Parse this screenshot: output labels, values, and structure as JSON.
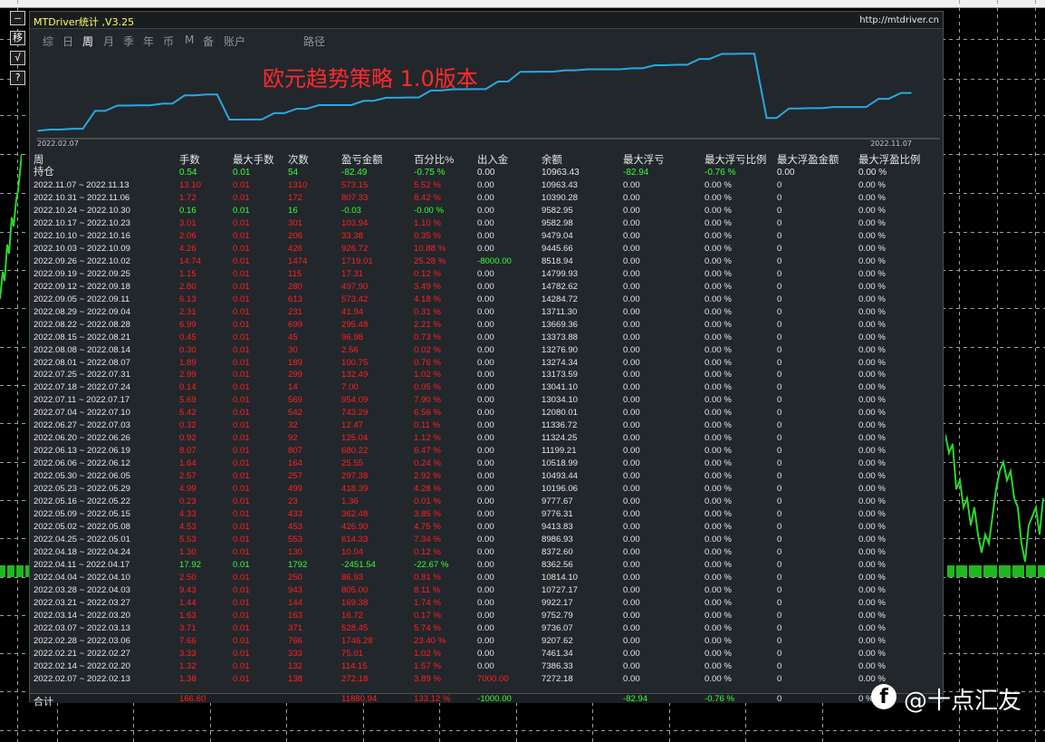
{
  "window": {
    "title": "MTDriver统计 ,V3.25",
    "url": "http://mtdriver.cn"
  },
  "toolbar_buttons": [
    "—",
    "移",
    "√",
    "?"
  ],
  "tabs": [
    {
      "label": "综",
      "active": false
    },
    {
      "label": "日",
      "active": false
    },
    {
      "label": "周",
      "active": true
    },
    {
      "label": "月",
      "active": false
    },
    {
      "label": "季",
      "active": false
    },
    {
      "label": "年",
      "active": false
    },
    {
      "label": "币",
      "active": false
    },
    {
      "label": "M",
      "active": false
    },
    {
      "label": "备",
      "active": false
    },
    {
      "label": "账户",
      "active": false
    },
    {
      "label": "路径",
      "active": false
    }
  ],
  "chart": {
    "title": "欧元趋势策略 1.0版本",
    "start_date": "2022.02.07",
    "end_date": "2022.11.07",
    "line_color": "#29a8e0"
  },
  "chart_data": {
    "type": "line",
    "title": "欧元趋势策略 1.0版本",
    "x_labels": [
      "2022.02.07",
      "2022.11.07"
    ],
    "series": [
      {
        "values": [
          7272.18,
          7386.33,
          7461.34,
          9207.62,
          9736.07,
          9752.79,
          9922.17,
          10727.17,
          10814.1,
          8362.56,
          8372.6,
          8986.93,
          9413.83,
          9776.31,
          9777.67,
          10196.06,
          10493.44,
          10518.99,
          11199.21,
          11324.25,
          11336.72,
          12080.01,
          13034.1,
          13041.1,
          13173.59,
          13274.34,
          13276.9,
          13373.88,
          13669.36,
          13711.3,
          14284.72,
          14782.62,
          14799.93,
          8518.94,
          9445.66,
          9479.04,
          9582.98,
          9582.95,
          10390.28,
          10963.43
        ]
      }
    ]
  },
  "table": {
    "headers": [
      "周",
      "手数",
      "最大手数",
      "次数",
      "盈亏金额",
      "百分比%",
      "出入金",
      "余额",
      "最大浮亏",
      "最大浮亏比例",
      "最大浮盈金额",
      "最大浮盈比例"
    ],
    "position": {
      "label": "持仓",
      "lots": "0.54",
      "max_lots": "0.01",
      "count": "54",
      "pnl": "-82.49",
      "pct": "-0.75 %",
      "flow": "0.00",
      "balance": "10963.43",
      "max_dd": "-82.94",
      "max_dd_pct": "-0.76 %",
      "max_fp": "0.00",
      "max_fp_pct": "0.00 %"
    },
    "rows": [
      [
        "2022.11.07 ~ 2022.11.13",
        "13.10",
        "0.01",
        "1310",
        "573.15",
        "5.52 %",
        "0.00",
        "10963.43",
        "0.00",
        "0.00 %",
        "0",
        "0.00 %"
      ],
      [
        "2022.10.31 ~ 2022.11.06",
        "1.72",
        "0.01",
        "172",
        "807.33",
        "8.42 %",
        "0.00",
        "10390.28",
        "0.00",
        "0.00 %",
        "0",
        "0.00 %"
      ],
      [
        "2022.10.24 ~ 2022.10.30",
        "0.16",
        "0.01",
        "16",
        "-0.03",
        "-0.00 %",
        "0.00",
        "9582.95",
        "0.00",
        "0.00 %",
        "0",
        "0.00 %"
      ],
      [
        "2022.10.17 ~ 2022.10.23",
        "3.01",
        "0.01",
        "301",
        "103.94",
        "1.10 %",
        "0.00",
        "9582.98",
        "0.00",
        "0.00 %",
        "0",
        "0.00 %"
      ],
      [
        "2022.10.10 ~ 2022.10.16",
        "2.06",
        "0.01",
        "206",
        "33.38",
        "0.35 %",
        "0.00",
        "9479.04",
        "0.00",
        "0.00 %",
        "0",
        "0.00 %"
      ],
      [
        "2022.10.03 ~ 2022.10.09",
        "4.26",
        "0.01",
        "426",
        "926.72",
        "10.88 %",
        "0.00",
        "9445.66",
        "0.00",
        "0.00 %",
        "0",
        "0.00 %"
      ],
      [
        "2022.09.26 ~ 2022.10.02",
        "14.74",
        "0.01",
        "1474",
        "1719.01",
        "25.28 %",
        "-8000.00",
        "8518.94",
        "0.00",
        "0.00 %",
        "0",
        "0.00 %"
      ],
      [
        "2022.09.19 ~ 2022.09.25",
        "1.15",
        "0.01",
        "115",
        "17.31",
        "0.12 %",
        "0.00",
        "14799.93",
        "0.00",
        "0.00 %",
        "0",
        "0.00 %"
      ],
      [
        "2022.09.12 ~ 2022.09.18",
        "2.80",
        "0.01",
        "280",
        "497.90",
        "3.49 %",
        "0.00",
        "14782.62",
        "0.00",
        "0.00 %",
        "0",
        "0.00 %"
      ],
      [
        "2022.09.05 ~ 2022.09.11",
        "6.13",
        "0.01",
        "613",
        "573.42",
        "4.18 %",
        "0.00",
        "14284.72",
        "0.00",
        "0.00 %",
        "0",
        "0.00 %"
      ],
      [
        "2022.08.29 ~ 2022.09.04",
        "2.31",
        "0.01",
        "231",
        "41.94",
        "0.31 %",
        "0.00",
        "13711.30",
        "0.00",
        "0.00 %",
        "0",
        "0.00 %"
      ],
      [
        "2022.08.22 ~ 2022.08.28",
        "6.99",
        "0.01",
        "699",
        "295.48",
        "2.21 %",
        "0.00",
        "13669.36",
        "0.00",
        "0.00 %",
        "0",
        "0.00 %"
      ],
      [
        "2022.08.15 ~ 2022.08.21",
        "0.45",
        "0.01",
        "45",
        "96.98",
        "0.73 %",
        "0.00",
        "13373.88",
        "0.00",
        "0.00 %",
        "0",
        "0.00 %"
      ],
      [
        "2022.08.08 ~ 2022.08.14",
        "0.30",
        "0.01",
        "30",
        "2.56",
        "0.02 %",
        "0.00",
        "13276.90",
        "0.00",
        "0.00 %",
        "0",
        "0.00 %"
      ],
      [
        "2022.08.01 ~ 2022.08.07",
        "1.89",
        "0.01",
        "189",
        "100.75",
        "0.76 %",
        "0.00",
        "13274.34",
        "0.00",
        "0.00 %",
        "0",
        "0.00 %"
      ],
      [
        "2022.07.25 ~ 2022.07.31",
        "2.99",
        "0.01",
        "299",
        "132.49",
        "1.02 %",
        "0.00",
        "13173.59",
        "0.00",
        "0.00 %",
        "0",
        "0.00 %"
      ],
      [
        "2022.07.18 ~ 2022.07.24",
        "0.14",
        "0.01",
        "14",
        "7.00",
        "0.05 %",
        "0.00",
        "13041.10",
        "0.00",
        "0.00 %",
        "0",
        "0.00 %"
      ],
      [
        "2022.07.11 ~ 2022.07.17",
        "5.69",
        "0.01",
        "569",
        "954.09",
        "7.90 %",
        "0.00",
        "13034.10",
        "0.00",
        "0.00 %",
        "0",
        "0.00 %"
      ],
      [
        "2022.07.04 ~ 2022.07.10",
        "5.42",
        "0.01",
        "542",
        "743.29",
        "6.56 %",
        "0.00",
        "12080.01",
        "0.00",
        "0.00 %",
        "0",
        "0.00 %"
      ],
      [
        "2022.06.27 ~ 2022.07.03",
        "0.32",
        "0.01",
        "32",
        "12.47",
        "0.11 %",
        "0.00",
        "11336.72",
        "0.00",
        "0.00 %",
        "0",
        "0.00 %"
      ],
      [
        "2022.06.20 ~ 2022.06.26",
        "0.92",
        "0.01",
        "92",
        "125.04",
        "1.12 %",
        "0.00",
        "11324.25",
        "0.00",
        "0.00 %",
        "0",
        "0.00 %"
      ],
      [
        "2022.06.13 ~ 2022.06.19",
        "8.07",
        "0.01",
        "807",
        "680.22",
        "6.47 %",
        "0.00",
        "11199.21",
        "0.00",
        "0.00 %",
        "0",
        "0.00 %"
      ],
      [
        "2022.06.06 ~ 2022.06.12",
        "1.64",
        "0.01",
        "164",
        "25.55",
        "0.24 %",
        "0.00",
        "10518.99",
        "0.00",
        "0.00 %",
        "0",
        "0.00 %"
      ],
      [
        "2022.05.30 ~ 2022.06.05",
        "2.57",
        "0.01",
        "257",
        "297.38",
        "2.92 %",
        "0.00",
        "10493.44",
        "0.00",
        "0.00 %",
        "0",
        "0.00 %"
      ],
      [
        "2022.05.23 ~ 2022.05.29",
        "4.99",
        "0.01",
        "499",
        "418.39",
        "4.28 %",
        "0.00",
        "10196.06",
        "0.00",
        "0.00 %",
        "0",
        "0.00 %"
      ],
      [
        "2022.05.16 ~ 2022.05.22",
        "0.23",
        "0.01",
        "23",
        "1.36",
        "0.01 %",
        "0.00",
        "9777.67",
        "0.00",
        "0.00 %",
        "0",
        "0.00 %"
      ],
      [
        "2022.05.09 ~ 2022.05.15",
        "4.33",
        "0.01",
        "433",
        "362.48",
        "3.85 %",
        "0.00",
        "9776.31",
        "0.00",
        "0.00 %",
        "0",
        "0.00 %"
      ],
      [
        "2022.05.02 ~ 2022.05.08",
        "4.53",
        "0.01",
        "453",
        "426.90",
        "4.75 %",
        "0.00",
        "9413.83",
        "0.00",
        "0.00 %",
        "0",
        "0.00 %"
      ],
      [
        "2022.04.25 ~ 2022.05.01",
        "5.53",
        "0.01",
        "553",
        "614.33",
        "7.34 %",
        "0.00",
        "8986.93",
        "0.00",
        "0.00 %",
        "0",
        "0.00 %"
      ],
      [
        "2022.04.18 ~ 2022.04.24",
        "1.30",
        "0.01",
        "130",
        "10.04",
        "0.12 %",
        "0.00",
        "8372.60",
        "0.00",
        "0.00 %",
        "0",
        "0.00 %"
      ],
      [
        "2022.04.11 ~ 2022.04.17",
        "17.92",
        "0.01",
        "1792",
        "-2451.54",
        "-22.67 %",
        "0.00",
        "8362.56",
        "0.00",
        "0.00 %",
        "0",
        "0.00 %"
      ],
      [
        "2022.04.04 ~ 2022.04.10",
        "2.50",
        "0.01",
        "250",
        "86.93",
        "0.81 %",
        "0.00",
        "10814.10",
        "0.00",
        "0.00 %",
        "0",
        "0.00 %"
      ],
      [
        "2022.03.28 ~ 2022.04.03",
        "9.43",
        "0.01",
        "943",
        "805.00",
        "8.11 %",
        "0.00",
        "10727.17",
        "0.00",
        "0.00 %",
        "0",
        "0.00 %"
      ],
      [
        "2022.03.21 ~ 2022.03.27",
        "1.44",
        "0.01",
        "144",
        "169.38",
        "1.74 %",
        "0.00",
        "9922.17",
        "0.00",
        "0.00 %",
        "0",
        "0.00 %"
      ],
      [
        "2022.03.14 ~ 2022.03.20",
        "1.63",
        "0.01",
        "163",
        "16.72",
        "0.17 %",
        "0.00",
        "9752.79",
        "0.00",
        "0.00 %",
        "0",
        "0.00 %"
      ],
      [
        "2022.03.07 ~ 2022.03.13",
        "3.71",
        "0.01",
        "371",
        "528.45",
        "5.74 %",
        "0.00",
        "9736.07",
        "0.00",
        "0.00 %",
        "0",
        "0.00 %"
      ],
      [
        "2022.02.28 ~ 2022.03.06",
        "7.66",
        "0.01",
        "766",
        "1746.28",
        "23.40 %",
        "0.00",
        "9207.62",
        "0.00",
        "0.00 %",
        "0",
        "0.00 %"
      ],
      [
        "2022.02.21 ~ 2022.02.27",
        "3.33",
        "0.01",
        "333",
        "75.01",
        "1.02 %",
        "0.00",
        "7461.34",
        "0.00",
        "0.00 %",
        "0",
        "0.00 %"
      ],
      [
        "2022.02.14 ~ 2022.02.20",
        "1.32",
        "0.01",
        "132",
        "114.15",
        "1.57 %",
        "0.00",
        "7386.33",
        "0.00",
        "0.00 %",
        "0",
        "0.00 %"
      ],
      [
        "2022.02.07 ~ 2022.02.13",
        "1.38",
        "0.01",
        "138",
        "272.18",
        "3.89 %",
        "7000.00",
        "7272.18",
        "0.00",
        "0.00 %",
        "0",
        "0.00 %"
      ]
    ],
    "totals": {
      "label": "合计",
      "lots": "166.60",
      "pnl": "11880.94",
      "pct": "133.12 %",
      "flow": "-1000.00",
      "max_dd": "-82.94",
      "max_dd_pct": "-0.76 %",
      "max_fp": "0",
      "max_fp_pct": "0 %"
    }
  },
  "watermark": {
    "text": "@十点汇友",
    "logo_letter": "f"
  },
  "colors": {
    "positive": "#ff2020",
    "negative": "#35ff35",
    "neutral": "#e6e6e6",
    "panel": "#22272c"
  }
}
